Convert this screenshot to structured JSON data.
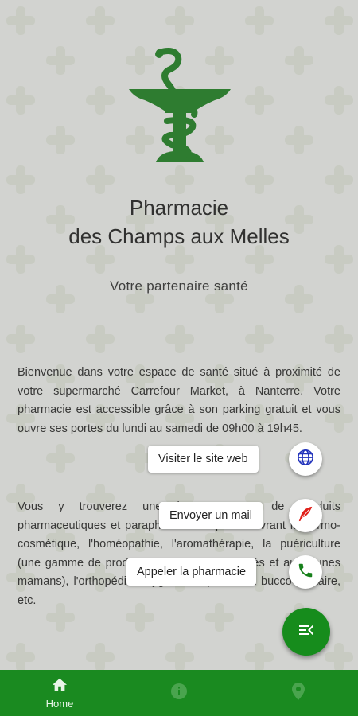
{
  "header": {
    "title_line1": "Pharmacie",
    "title_line2": "des Champs aux Melles",
    "subtitle": "Votre partenaire santé"
  },
  "intro": {
    "paragraph1": "Bienvenue dans votre espace de santé situé à proximité de votre supermarché Carrefour Market, à Nanterre. Votre pharmacie est accessible grâce à son parking gratuit et vous ouvre ses portes du lundi au samedi de 09h00 à 19h45.",
    "paragraph2": "Vous y trouverez une large gamme de produits pharmaceutiques et parapharmaceutiques couvrant la dermo-cosmétique, l'homéopathie, l'aromathérapie, la puériculture (une gamme de produits est dédiée aux bébés et aux jeunes mamans), l'orthopédie, l'hygiène corporelle et bucco-dentaire, etc."
  },
  "speed_dial": {
    "website_label": "Visiter le site web",
    "mail_label": "Envoyer un mail",
    "call_label": "Appeler la pharmacie",
    "website_icon": "globe-icon",
    "mail_icon": "feather-icon",
    "call_icon": "phone-icon",
    "fab_icon": "menu-close-icon"
  },
  "bottom_nav": {
    "items": [
      {
        "label": "Home",
        "icon": "home-icon",
        "active": true
      },
      {
        "label": "",
        "icon": "info-icon",
        "active": false
      },
      {
        "label": "",
        "icon": "map-pin-icon",
        "active": false
      }
    ]
  },
  "colors": {
    "primary_green": "#1a8a20",
    "background": "#e6e7e4",
    "globe_blue": "#2233bb",
    "feather_red": "#e0201a"
  }
}
